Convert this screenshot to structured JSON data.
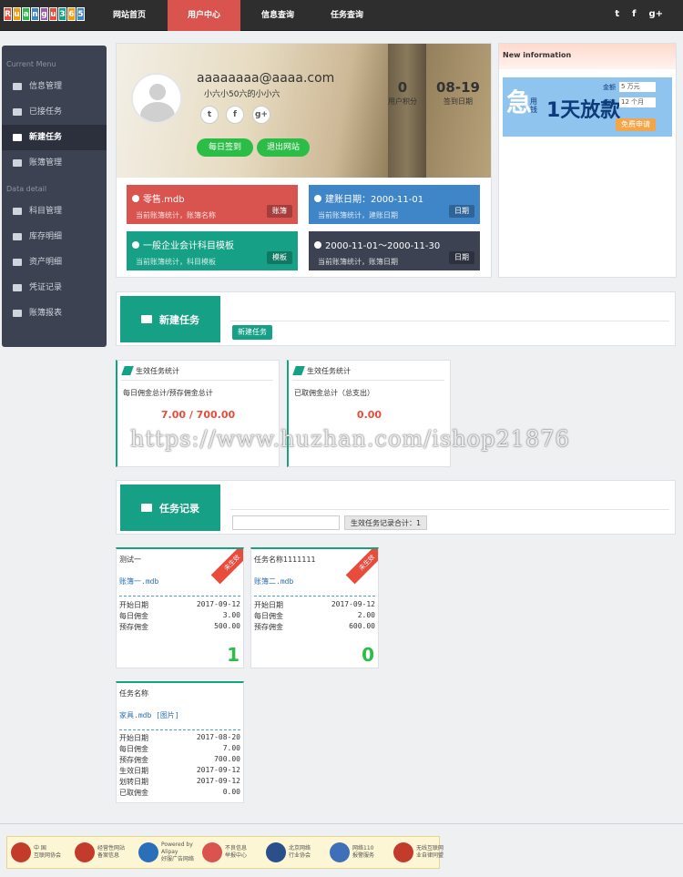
{
  "header": {
    "logo_letters": [
      "R",
      "u",
      "a",
      "n",
      "g",
      "u",
      "3",
      "6",
      "5"
    ],
    "nav": [
      "网站首页",
      "用户中心",
      "信息查询",
      "任务查询"
    ],
    "social": [
      "t",
      "f",
      "g+"
    ]
  },
  "sidebar": {
    "section1": "Current Menu",
    "items1": [
      "信息管理",
      "已接任务",
      "新建任务",
      "账簿管理"
    ],
    "section2": "Data detail",
    "items2": [
      "科目管理",
      "库存明细",
      "资产明细",
      "凭证记录",
      "账簿报表"
    ]
  },
  "profile": {
    "email": "aaaaaaaa@aaaa.com",
    "subname": "小六小50六的小小六",
    "social": [
      "t",
      "f",
      "g+"
    ],
    "btn_sign": "每日签到",
    "btn_logout": "退出网站",
    "points_value": "0",
    "points_label": "用户积分",
    "date_value": "08-19",
    "date_label": "签到日期"
  },
  "cards": [
    {
      "title": "零售.mdb",
      "sub": "当前账簿统计，账簿名称",
      "tag": "账簿",
      "color": "#d9534f"
    },
    {
      "title": "建账日期：2000-11-01",
      "sub": "当前账簿统计，建账日期",
      "tag": "日期",
      "color": "#3f86c8"
    },
    {
      "title": "一般企业会计科目模板",
      "sub": "当前账簿统计，科目模板",
      "tag": "模板",
      "color": "#16a085"
    },
    {
      "title": "2000-11-01～2000-11-30",
      "sub": "当前账簿统计，账簿日期",
      "tag": "日期",
      "color": "#3c4252"
    }
  ],
  "new_info": {
    "title": "New information",
    "ad_big": "急",
    "ad_text": "1天放款",
    "ad_small": "用钱",
    "amount_label": "金额",
    "amount_value": "5 万元",
    "term_label": "期限",
    "term_value": "12 个月",
    "ad_button": "免费申请"
  },
  "new_task": {
    "title": "新建任务",
    "button": "新建任务"
  },
  "stats": [
    {
      "title": "生效任务统计",
      "label": "每日佣金总计/预存佣金总计",
      "value": "7.00 / 700.00"
    },
    {
      "title": "生效任务统计",
      "label": "已取佣金总计（总支出）",
      "value": "0.00"
    }
  ],
  "task_records": {
    "title": "任务记录",
    "input_value": "",
    "button": "生效任务记录合计：1"
  },
  "tasks": [
    {
      "name": "测试一",
      "file": "账簿一.mdb",
      "ribbon": "未生效",
      "rows": [
        [
          "开始日期",
          "2017-09-12"
        ],
        [
          "每日佣金",
          "3.00"
        ],
        [
          "预存佣金",
          "500.00"
        ]
      ],
      "num": "1"
    },
    {
      "name": "任务名称1111111",
      "file": "账簿二.mdb",
      "ribbon": "未生效",
      "rows": [
        [
          "开始日期",
          "2017-09-12"
        ],
        [
          "每日佣金",
          "2.00"
        ],
        [
          "预存佣金",
          "600.00"
        ]
      ],
      "num": "0"
    },
    {
      "name": "任务名称",
      "file": "家具.mdb [图片]",
      "ribbon": "",
      "rows": [
        [
          "开始日期",
          "2017-08-20"
        ],
        [
          "每日佣金",
          "7.00"
        ],
        [
          "预存佣金",
          "700.00"
        ],
        [
          "生效日期",
          "2017-09-12"
        ],
        [
          "划转日期",
          "2017-09-12"
        ],
        [
          "已取佣金",
          "0.00"
        ]
      ],
      "num": ""
    }
  ],
  "watermark": "https://www.huzhan.com/ishop21876",
  "footer": [
    {
      "label": "中 国\n互联网协会",
      "color": "#c23b2b"
    },
    {
      "label": "经营性网站\n备案信息",
      "color": "#c23b2b"
    },
    {
      "label": "Powered by Alipay\n好服广告网络",
      "color": "#2a6fb8"
    },
    {
      "label": "不良信息\n举报中心",
      "color": "#d9534f"
    },
    {
      "label": "北京网络\n行业协会",
      "color": "#2a4f8a"
    },
    {
      "label": "网络110\n报警服务",
      "color": "#3f6fb8"
    },
    {
      "label": "无线互联网\n业自律同盟",
      "color": "#c23b2b"
    }
  ]
}
